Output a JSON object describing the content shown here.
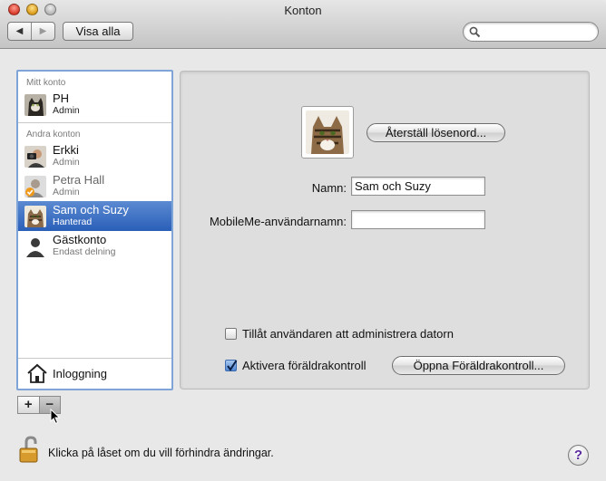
{
  "window": {
    "title": "Konton"
  },
  "toolbar": {
    "back_glyph": "◀",
    "forward_glyph": "▶",
    "show_all_label": "Visa alla",
    "search_placeholder": ""
  },
  "accounts": {
    "my_account_header": "Mitt konto",
    "other_accounts_header": "Andra konton",
    "my_account": {
      "name": "PH",
      "role": "Admin"
    },
    "others": [
      {
        "name": "Erkki",
        "role": "Admin"
      },
      {
        "name": "Petra Hall",
        "role": "Admin"
      },
      {
        "name": "Sam och Suzy",
        "role": "Hanterad"
      },
      {
        "name": "Gästkonto",
        "role": "Endast delning"
      }
    ],
    "login_label": "Inloggning",
    "selected_index": 2
  },
  "list_controls": {
    "add_label": "+",
    "remove_label": "−"
  },
  "detail": {
    "reset_password_label": "Återställ lösenord...",
    "name_label": "Namn:",
    "name_value": "Sam och Suzy",
    "mobileme_label": "MobileMe-användarnamn:",
    "mobileme_value": "",
    "allow_admin_label": "Tillåt användaren att administrera datorn",
    "allow_admin_checked": false,
    "parental_label": "Aktivera föräldrakontroll",
    "parental_checked": true,
    "open_parental_label": "Öppna Föräldrakontroll..."
  },
  "footer": {
    "lock_text": "Klicka på låset om du vill förhindra ändringar.",
    "help_label": "?"
  },
  "colors": {
    "selection": "#2a5fb8",
    "list_border": "#7ea4d8",
    "help_glyph": "#5a2ca0"
  }
}
